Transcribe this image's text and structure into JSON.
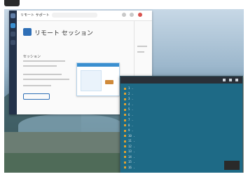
{
  "main_window": {
    "app_name": "リモート サポート",
    "search_placeholder": "",
    "page_title": "リモート セッション",
    "page_subtitle": "",
    "section_label": "セッション",
    "action_label": "",
    "footer_text": "",
    "side_pane_label": ""
  },
  "terminal_window": {
    "title": "",
    "lines": [
      "1 .",
      "2 .",
      "3 .",
      "4 .",
      "5 .",
      "6 .",
      "7 .",
      "8 .",
      "9 .",
      "10 .",
      "11 .",
      "12 .",
      "13 .",
      "14 .",
      "15 .",
      "16 ."
    ]
  },
  "caption": "",
  "colors": {
    "accent": "#2f6fb6",
    "nav_rail": "#23324a",
    "terminal_bg": "#1e6a86",
    "terminal_marker": "#e0a030"
  }
}
